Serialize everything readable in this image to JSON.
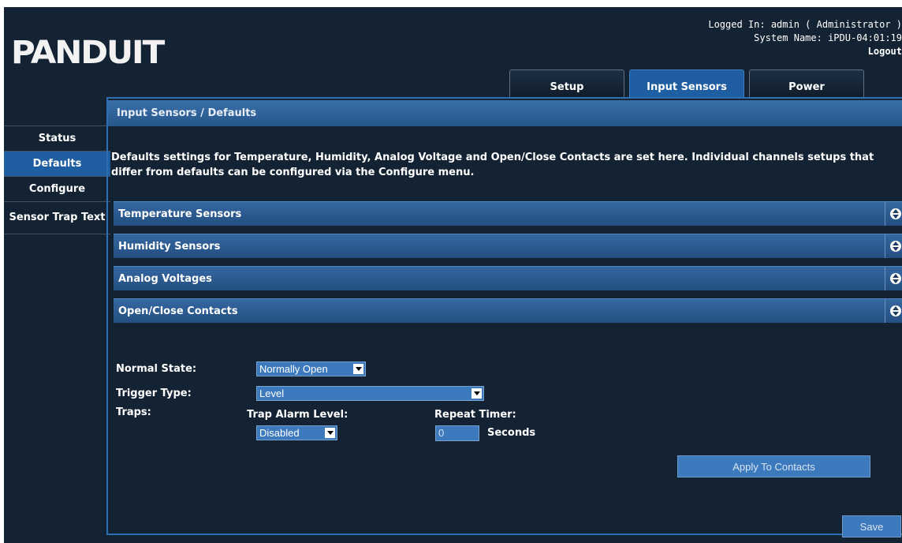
{
  "header": {
    "logo": "PANDUIT",
    "logged_in": "Logged In: admin ( Administrator )",
    "system_name": "System Name: iPDU-04:01:19",
    "logout": "Logout"
  },
  "tabs": [
    {
      "label": "Setup"
    },
    {
      "label": "Input Sensors"
    },
    {
      "label": "Power"
    }
  ],
  "sidebar": {
    "items": [
      {
        "label": "Status"
      },
      {
        "label": "Defaults"
      },
      {
        "label": "Configure"
      },
      {
        "label": "Sensor Trap Text"
      }
    ]
  },
  "main": {
    "breadcrumb": "Input Sensors / Defaults",
    "description": "Defaults settings for Temperature, Humidity, Analog Voltage and Open/Close Contacts are set here. Individual channels setups that differ from defaults can be configured via the Configure menu.",
    "sections": [
      {
        "label": "Temperature Sensors"
      },
      {
        "label": "Humidity Sensors"
      },
      {
        "label": "Analog Voltages"
      },
      {
        "label": "Open/Close Contacts"
      }
    ],
    "form": {
      "normal_state_label": "Normal State:",
      "normal_state_value": "Normally Open",
      "trigger_type_label": "Trigger Type:",
      "trigger_type_value": "Level",
      "traps_label": "Traps:",
      "trap_alarm_level_label": "Trap Alarm Level:",
      "trap_alarm_level_value": "Disabled",
      "repeat_timer_label": "Repeat Timer:",
      "repeat_timer_value": "0",
      "seconds_label": "Seconds",
      "apply_button": "Apply To Contacts",
      "save_button": "Save"
    }
  },
  "colors": {
    "background": "#142333",
    "accent": "#1f5ea0",
    "field": "#3c79bd"
  }
}
